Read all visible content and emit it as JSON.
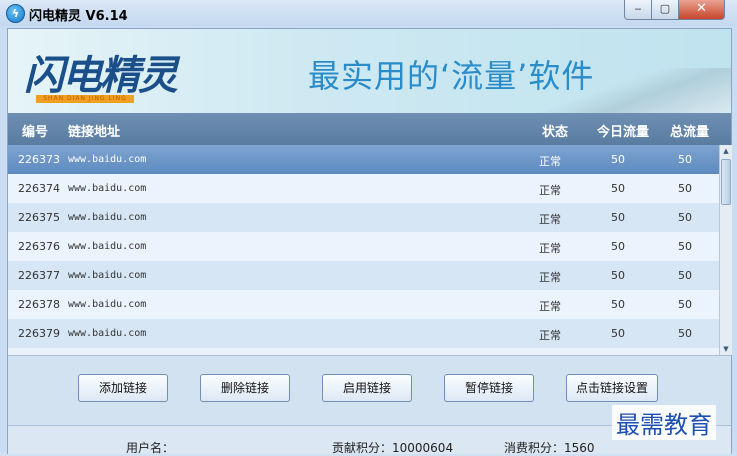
{
  "window": {
    "title": "闪电精灵 V6.14",
    "icon": "lightning-app-icon",
    "controls": {
      "minimize": "‒",
      "maximize": "▢",
      "close": "✕"
    }
  },
  "banner": {
    "logo": "闪电精灵",
    "logo_sub": "SHAN DIAN JING LING",
    "slogan": "最实用的‘流量’软件"
  },
  "grid": {
    "columns": [
      "编号",
      "链接地址",
      "状态",
      "今日流量",
      "总流量"
    ],
    "rows": [
      {
        "id": "226373",
        "url": "www.baidu.com",
        "status": "正常",
        "today": "50",
        "total": "50"
      },
      {
        "id": "226374",
        "url": "www.baidu.com",
        "status": "正常",
        "today": "50",
        "total": "50"
      },
      {
        "id": "226375",
        "url": "www.baidu.com",
        "status": "正常",
        "today": "50",
        "total": "50"
      },
      {
        "id": "226376",
        "url": "www.baidu.com",
        "status": "正常",
        "today": "50",
        "total": "50"
      },
      {
        "id": "226377",
        "url": "www.baidu.com",
        "status": "正常",
        "today": "50",
        "total": "50"
      },
      {
        "id": "226378",
        "url": "www.baidu.com",
        "status": "正常",
        "today": "50",
        "total": "50"
      },
      {
        "id": "226379",
        "url": "www.baidu.com",
        "status": "正常",
        "today": "50",
        "total": "50"
      }
    ],
    "selected_row": 0
  },
  "actions": {
    "add": "添加链接",
    "delete": "删除链接",
    "enable": "启用链接",
    "pause": "暂停链接",
    "settings": "点击链接设置"
  },
  "status_bar": {
    "username": "用户名：",
    "contribution": "贡献积分：10000604",
    "consumption": "消费积分：1560"
  },
  "watermark": "最需教育",
  "colors": {
    "header": "#5a7ca1",
    "selected": "#6e96c8",
    "accent": "#2a8cc9"
  }
}
